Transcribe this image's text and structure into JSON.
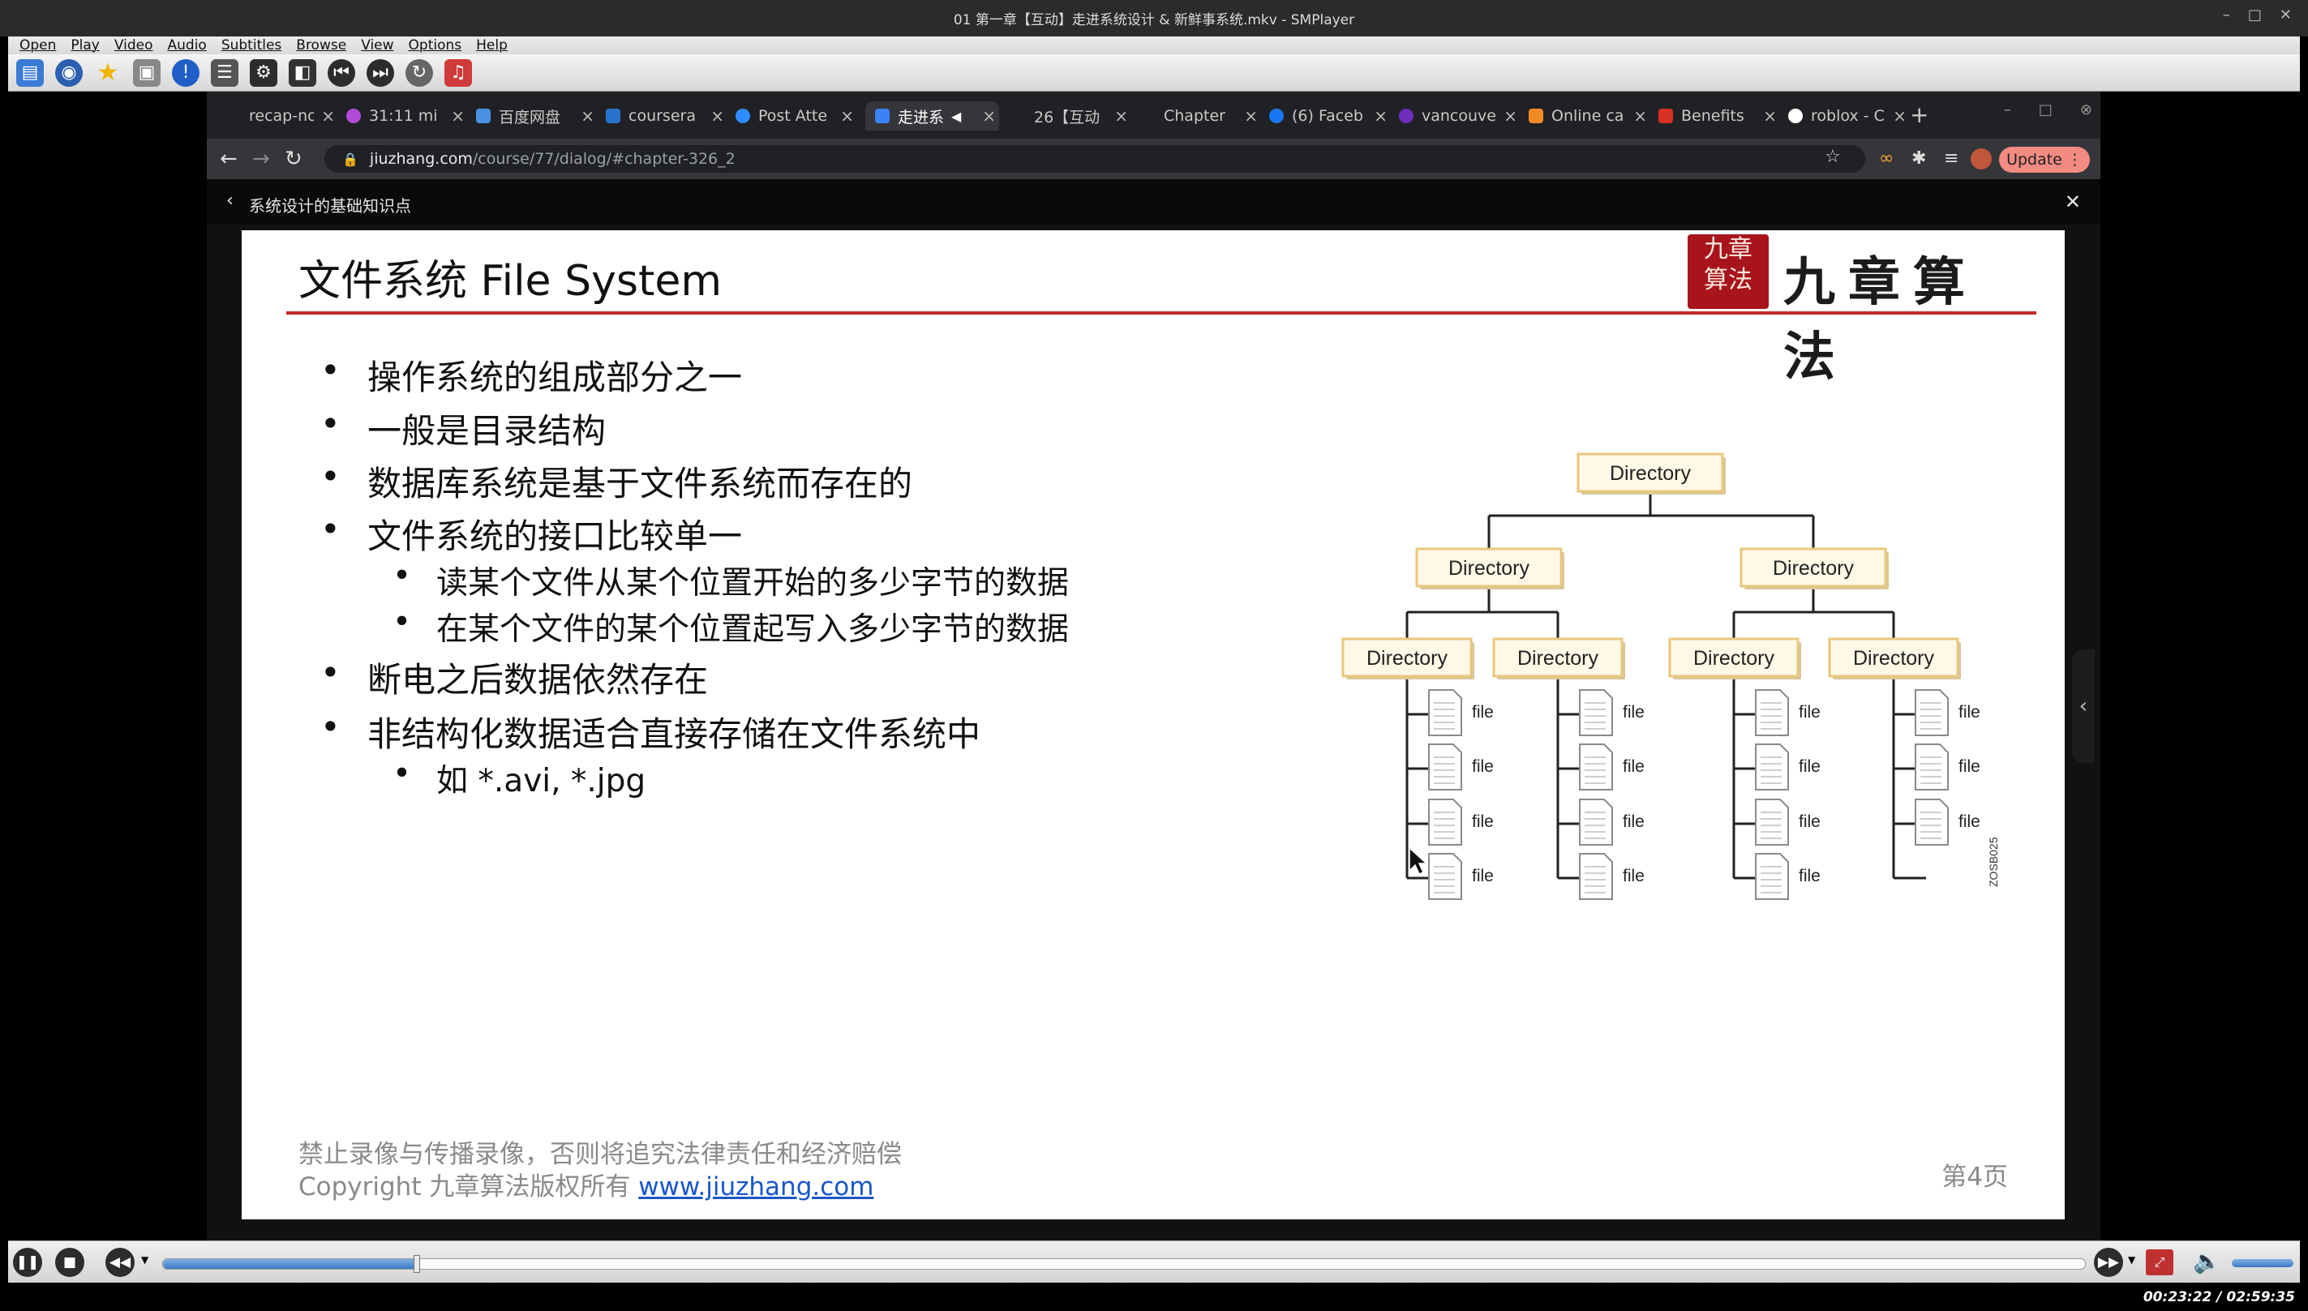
{
  "window": {
    "title": "01 第一章【互动】走进系统设计 & 新鲜事系统.mkv - SMPlayer",
    "controls": [
      "–",
      "□",
      "✕"
    ]
  },
  "menu": [
    "Open",
    "Play",
    "Video",
    "Audio",
    "Subtitles",
    "Browse",
    "View",
    "Options",
    "Help"
  ],
  "toolbar_icons": [
    "open-file-icon",
    "open-url-icon",
    "favorites-icon",
    "screenshot-icon",
    "info-icon",
    "playlist-icon",
    "preferences-icon",
    "screenshot-capture-icon",
    "previous-icon",
    "next-icon",
    "ab-loop-icon",
    "equalizer-icon"
  ],
  "browser": {
    "tabs": [
      {
        "label": "recap-no",
        "active": false,
        "fav_color": "#5f6368"
      },
      {
        "label": "31:11 mi",
        "active": false,
        "fav_color": "#b04bd8"
      },
      {
        "label": "百度网盘",
        "active": false,
        "fav_color": "#4a90e2"
      },
      {
        "label": "coursera",
        "active": false,
        "fav_color": "#2a73cc"
      },
      {
        "label": "Post Atte",
        "active": false,
        "fav_color": "#2d8cff"
      },
      {
        "label": "走进系",
        "active": true,
        "fav_color": "#3b82f6"
      },
      {
        "label": "26【互动",
        "active": false,
        "fav_color": "#333333"
      },
      {
        "label": "Chapter",
        "active": false,
        "fav_color": "#333333"
      },
      {
        "label": "(6) Faceb",
        "active": false,
        "fav_color": "#1877f2"
      },
      {
        "label": "vancouve",
        "active": false,
        "fav_color": "#6f2dbd"
      },
      {
        "label": "Online ca",
        "active": false,
        "fav_color": "#f08a24"
      },
      {
        "label": "Benefits",
        "active": false,
        "fav_color": "#d93025"
      },
      {
        "label": "roblox - C",
        "active": false,
        "fav_color": "#ffffff"
      }
    ],
    "url_host": "jiuzhang.com",
    "url_path": "/course/77/dialog/#chapter-326_2",
    "update_label": "Update",
    "page_back_label": "系统设计的基础知识点",
    "close_glyph": "✕"
  },
  "slide": {
    "title": "文件系统 File System",
    "logo_seal": [
      "九章",
      "算法"
    ],
    "logo_text": "九章算法",
    "bullets": [
      {
        "level": 1,
        "text": "操作系统的组成部分之一"
      },
      {
        "level": 1,
        "text": "一般是目录结构"
      },
      {
        "level": 1,
        "text": "数据库系统是基于文件系统而存在的"
      },
      {
        "level": 1,
        "text": "文件系统的接口比较单一"
      },
      {
        "level": 2,
        "text": "读某个文件从某个位置开始的多少字节的数据"
      },
      {
        "level": 2,
        "text": "在某个文件的某个位置起写入多少字节的数据"
      },
      {
        "level": 1,
        "text": "断电之后数据依然存在"
      },
      {
        "level": 1,
        "text": "非结构化数据适合直接存储在文件系统中"
      },
      {
        "level": 2,
        "text": "如 *.avi, *.jpg"
      }
    ],
    "diagram": {
      "root_label": "Directory",
      "level2_label": "Directory",
      "level3_label": "Directory",
      "file_label": "file",
      "figure_id": "ZOSB025",
      "file_counts": [
        4,
        4,
        4,
        3
      ]
    },
    "footer_line1": "禁止录像与传播录像，否则将追究法律责任和经济赔偿",
    "footer_line2_prefix": "Copyright 九章算法版权所有 ",
    "footer_link": "www.jiuzhang.com",
    "page_number": "第4页"
  },
  "player": {
    "progress_fraction": 0.1317,
    "time_display": "00:23:22 / 02:59:35"
  }
}
